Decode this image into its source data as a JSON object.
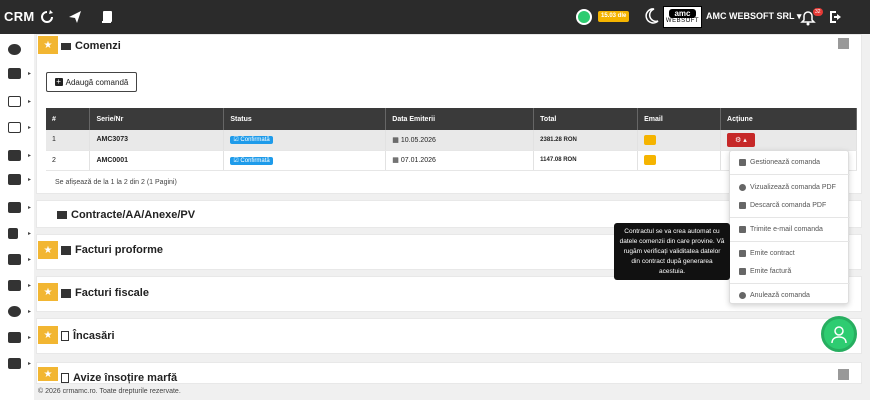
{
  "topbar": {
    "brand": "CRM",
    "badge": "15.03 dle",
    "logo_top": "amc",
    "logo_bottom": "WEBSOFT",
    "company": "AMC WEBSOFT SRL",
    "notifications": "32"
  },
  "comenzi": {
    "title": "Comenzi",
    "add_button": "Adaugă comandă",
    "columns": [
      "#",
      "Serie/Nr",
      "Status",
      "Data Emiterii",
      "Total",
      "Email",
      "Acțiune"
    ],
    "rows": [
      {
        "idx": "1",
        "nr": "AMC3073",
        "status": "Confirmată",
        "date": "10.05.2026",
        "total": "2381.28 RON"
      },
      {
        "idx": "2",
        "nr": "AMC0001",
        "status": "Confirmată",
        "date": "07.01.2026",
        "total": "1147.08 RON"
      }
    ],
    "info": "Se afișează de la 1 la 2 din 2 (1 Pagini)"
  },
  "dropdown": {
    "items": [
      "Gestionează comanda",
      "Vizualizează comanda PDF",
      "Descarcă comanda PDF",
      "Trimite e-mail comanda",
      "Emite contract",
      "Emite factură",
      "Anulează comanda"
    ]
  },
  "tooltip": "Contractul se va crea automat cu datele comenzii din care provine. Vă rugăm verificați validitatea datelor din contract după generarea acestuia.",
  "sections": {
    "contracte": "Contracte/AA/Anexe/PV",
    "proforme": "Facturi proforme",
    "fiscale": "Facturi fiscale",
    "incasari": "Încasări",
    "avize": "Avize însoțire marfă"
  },
  "footer": "© 2026 crmamc.ro. Toate drepturile rezervate.",
  "colors": {
    "accent": "#f2b632",
    "status": "#1e9bea",
    "danger": "#c62828",
    "header": "#2b2b2b"
  }
}
